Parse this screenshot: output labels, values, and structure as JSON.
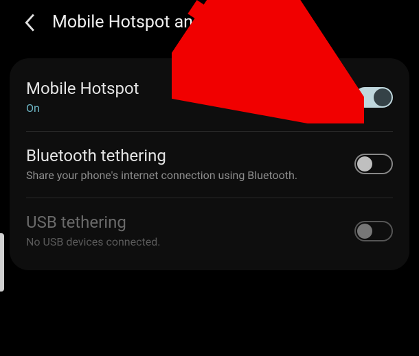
{
  "header": {
    "title": "Mobile Hotspot and Tethering"
  },
  "items": [
    {
      "title": "Mobile Hotspot",
      "subtitle": "On",
      "subtitle_accent": true,
      "enabled": true,
      "toggled": true
    },
    {
      "title": "Bluetooth tethering",
      "subtitle": "Share your phone's internet connection using Bluetooth.",
      "subtitle_accent": false,
      "enabled": true,
      "toggled": false
    },
    {
      "title": "USB tethering",
      "subtitle": "No USB devices connected.",
      "subtitle_accent": false,
      "enabled": false,
      "toggled": false
    }
  ],
  "annotation": {
    "type": "arrow",
    "color": "#f10000",
    "target": "mobile-hotspot-toggle"
  }
}
